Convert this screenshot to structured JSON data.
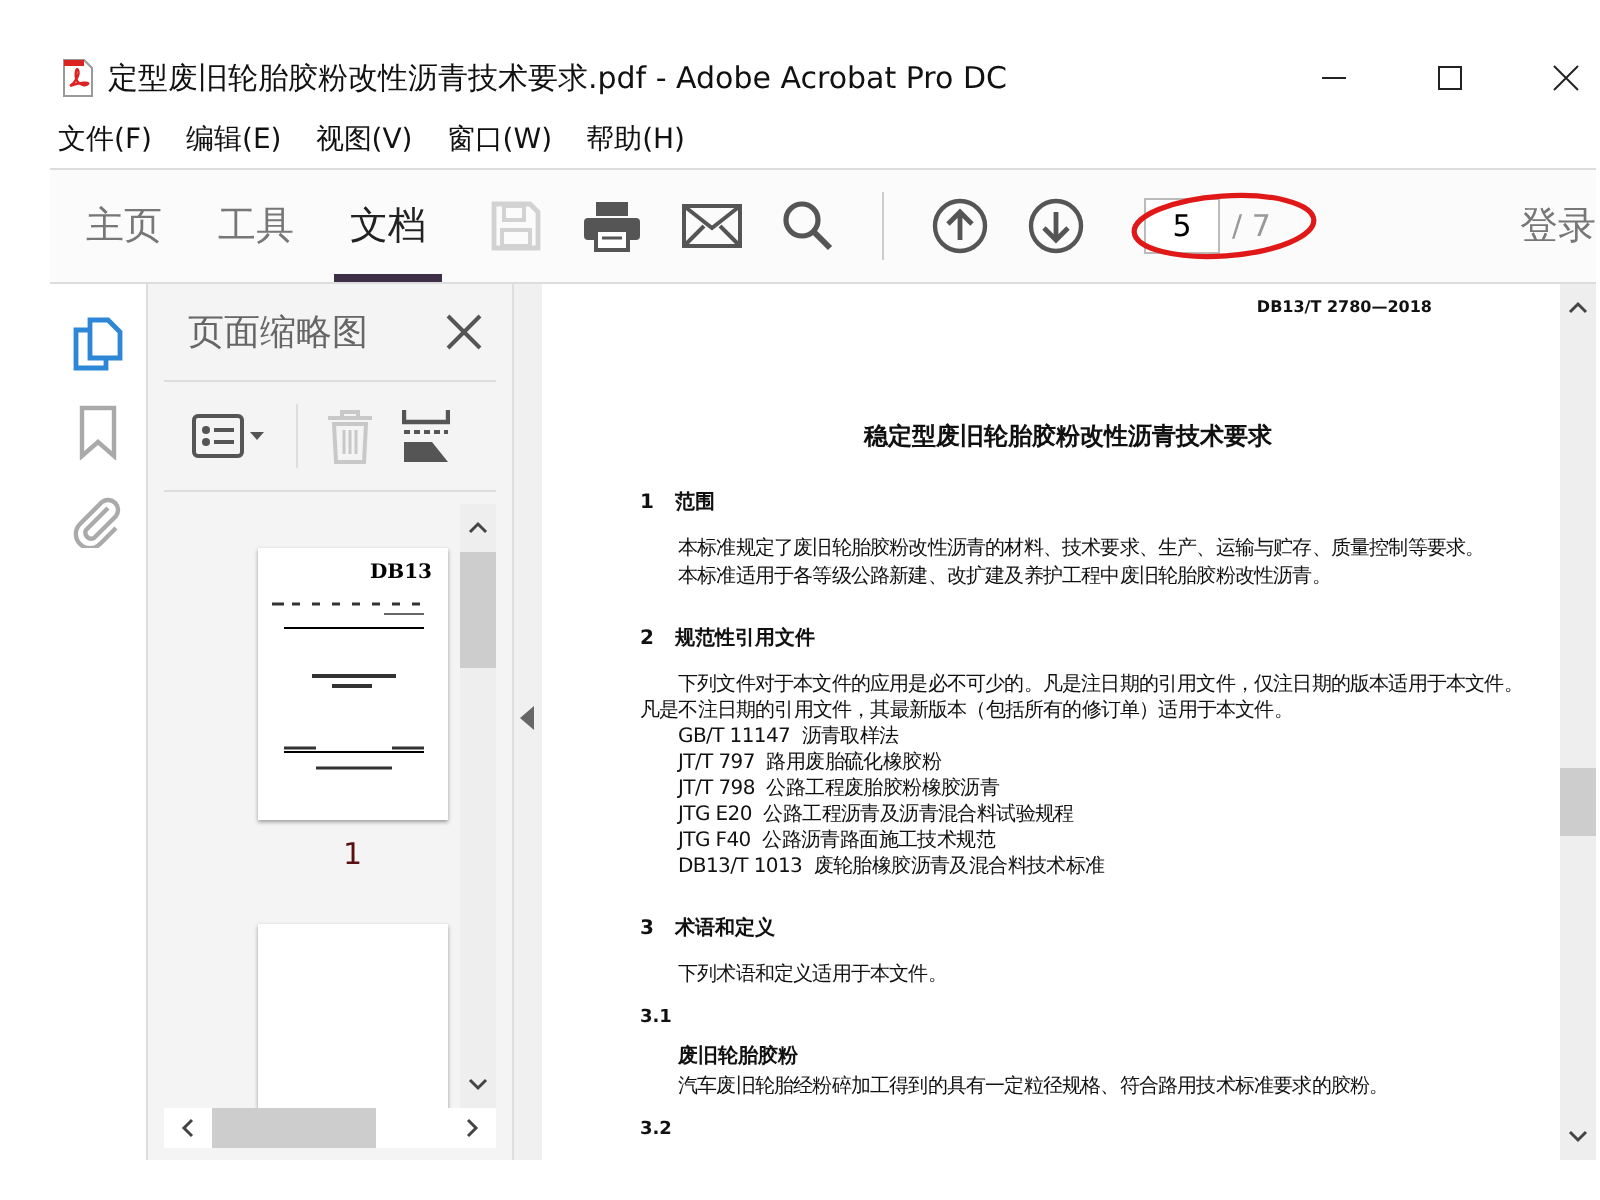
{
  "window": {
    "title": "定型废旧轮胎胶粉改性沥青技术要求.pdf - Adobe Acrobat Pro DC"
  },
  "menu": [
    "文件(F)",
    "编辑(E)",
    "视图(V)",
    "窗口(W)",
    "帮助(H)"
  ],
  "toolbar": {
    "tabs": [
      {
        "label": "主页",
        "selected": false
      },
      {
        "label": "工具",
        "selected": false
      },
      {
        "label": "文档",
        "selected": true
      }
    ],
    "tools": [
      {
        "kind": "save",
        "disabled": true
      },
      {
        "kind": "print",
        "disabled": false
      },
      {
        "kind": "mail",
        "disabled": false
      },
      {
        "kind": "search",
        "disabled": false
      },
      {
        "kind": "divider"
      },
      {
        "kind": "up",
        "disabled": false
      },
      {
        "kind": "down",
        "disabled": false
      }
    ],
    "page_field": {
      "value": "5"
    },
    "page_count": "/ 7",
    "sign_in": "登录"
  },
  "side_rail": [
    {
      "kind": "pages",
      "selected": true
    },
    {
      "kind": "bookmarks",
      "selected": false
    },
    {
      "kind": "attachments",
      "selected": false
    }
  ],
  "thumbnail_panel": {
    "title": "页面缩略图",
    "tools": [
      {
        "kind": "options",
        "disabled": false
      },
      {
        "kind": "delete",
        "disabled": true
      },
      {
        "kind": "extract",
        "disabled": false
      }
    ],
    "pages": [
      {
        "kind": "cover",
        "heading": "DB13",
        "label": "1"
      },
      {
        "kind": "blank"
      }
    ]
  },
  "document": {
    "code": "DB13/T 2780—2018",
    "title": "稳定型废旧轮胎胶粉改性沥青技术要求",
    "blocks": [
      {
        "kind": "heading",
        "number": "1",
        "text": "范围"
      },
      {
        "kind": "para",
        "text": "本标准规定了废旧轮胎胶粉改性沥青的材料、技术要求、生产、运输与贮存、质量控制等要求。"
      },
      {
        "kind": "para",
        "text": "本标准适用于各等级公路新建、改扩建及养护工程中废旧轮胎胶粉改性沥青。"
      },
      {
        "kind": "heading",
        "number": "2",
        "text": "规范性引用文件"
      },
      {
        "kind": "para",
        "text": "下列文件对于本文件的应用是必不可少的。凡是注日期的引用文件，仅注日期的版本适用于本文件。凡是不注日期的引用文件，其最新版本（包括所有的修订单）适用于本文件。"
      },
      {
        "kind": "ref",
        "number": "GB/T 11147",
        "text": "沥青取样法"
      },
      {
        "kind": "ref",
        "number": "JT/T 797",
        "text": "路用废胎硫化橡胶粉"
      },
      {
        "kind": "ref",
        "number": "JT/T 798",
        "text": "公路工程废胎胶粉橡胶沥青"
      },
      {
        "kind": "ref",
        "number": "JTG E20",
        "text": "公路工程沥青及沥青混合料试验规程"
      },
      {
        "kind": "ref",
        "number": "JTG F40",
        "text": "公路沥青路面施工技术规范"
      },
      {
        "kind": "ref",
        "number": "DB13/T 1013",
        "text": "废轮胎橡胶沥青及混合料技术标准"
      },
      {
        "kind": "heading",
        "number": "3",
        "text": "术语和定义"
      },
      {
        "kind": "para",
        "text": "下列术语和定义适用于本文件。"
      },
      {
        "kind": "clause",
        "number": "3.1"
      },
      {
        "kind": "term",
        "text": "废旧轮胎胶粉"
      },
      {
        "kind": "para",
        "text": "汽车废旧轮胎经粉碎加工得到的具有一定粒径规格、符合路用技术标准要求的胶粉。"
      },
      {
        "kind": "clause",
        "number": "3.2"
      }
    ]
  }
}
